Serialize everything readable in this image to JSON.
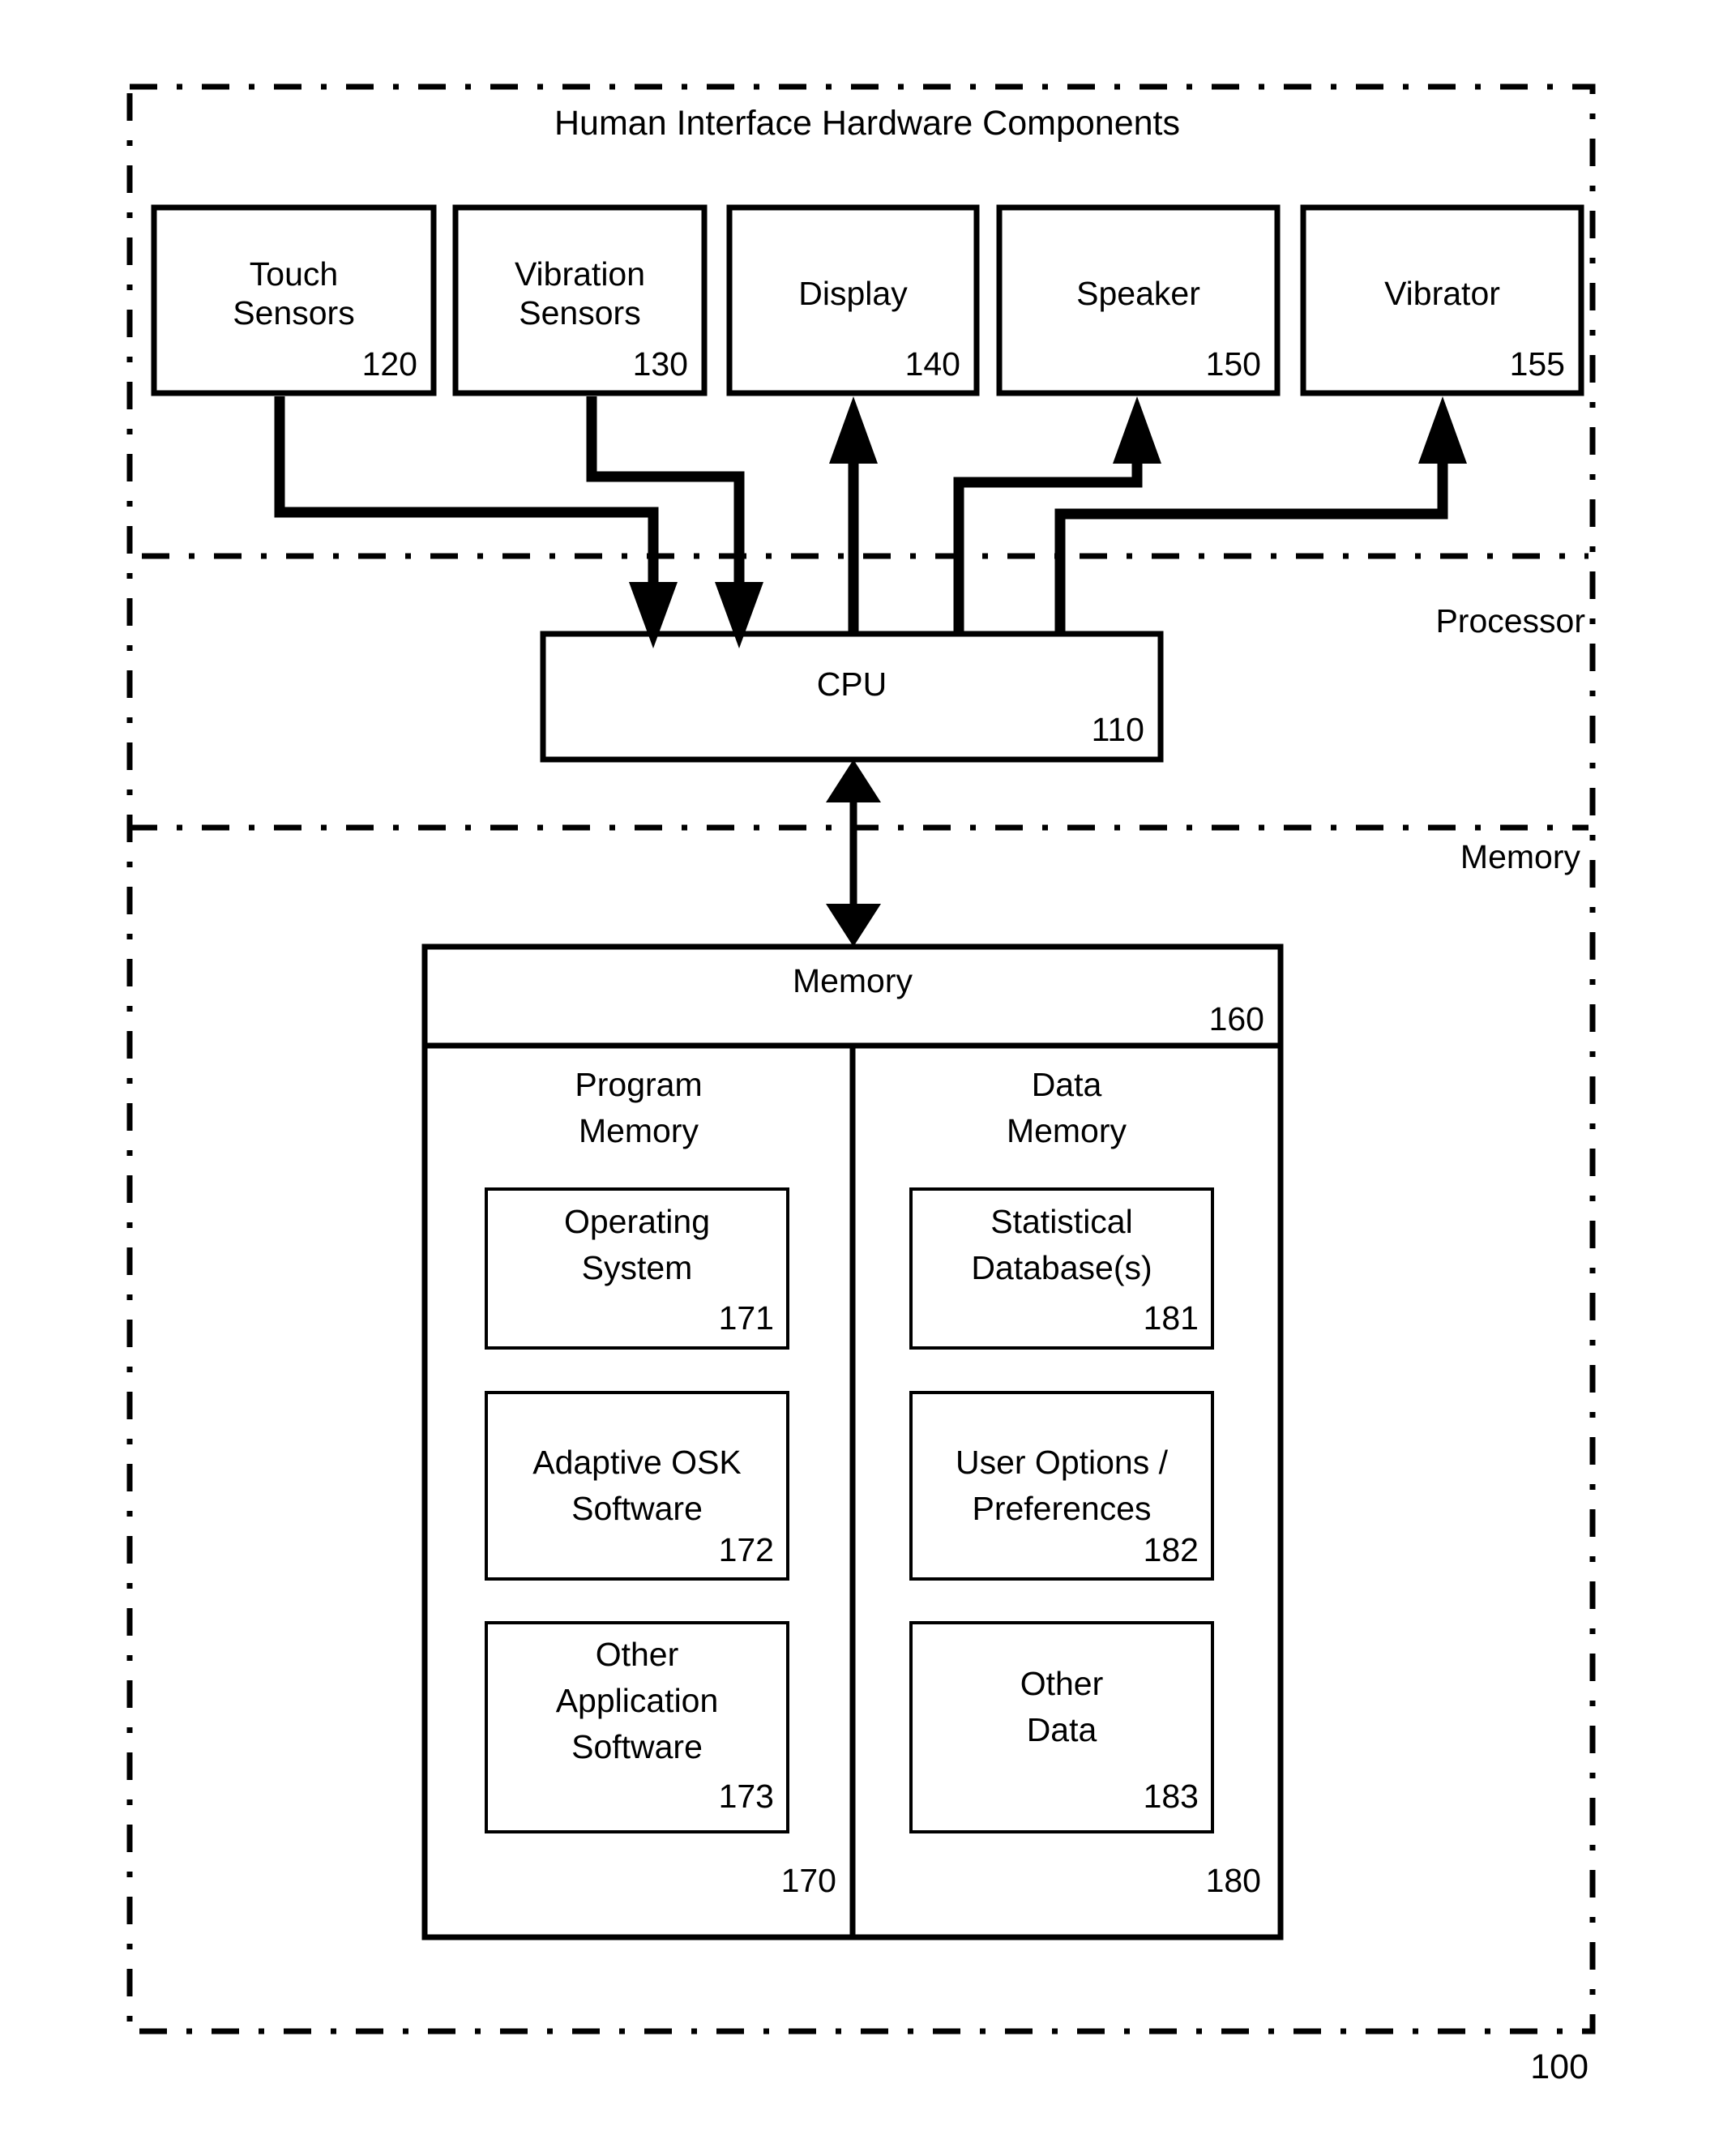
{
  "figure": {
    "outer_label": "100",
    "title": "Human Interface Hardware Components",
    "section_labels": {
      "processor": "Processor",
      "memory": "Memory"
    }
  },
  "hardware_components": [
    {
      "name": "touch-sensors",
      "label_line1": "Touch",
      "label_line2": "Sensors",
      "ref": "120"
    },
    {
      "name": "vibration-sensors",
      "label_line1": "Vibration",
      "label_line2": "Sensors",
      "ref": "130"
    },
    {
      "name": "display",
      "label_line1": "Display",
      "label_line2": "",
      "ref": "140"
    },
    {
      "name": "speaker",
      "label_line1": "Speaker",
      "label_line2": "",
      "ref": "150"
    },
    {
      "name": "vibrator",
      "label_line1": "Vibrator",
      "label_line2": "",
      "ref": "155"
    }
  ],
  "processor": {
    "cpu": {
      "label": "CPU",
      "ref": "110"
    }
  },
  "memory": {
    "header": {
      "label": "Memory",
      "ref": "160"
    },
    "program_memory": {
      "title_line1": "Program",
      "title_line2": "Memory",
      "ref": "170",
      "items": [
        {
          "line1": "Operating",
          "line2": "System",
          "line3": "",
          "ref": "171"
        },
        {
          "line1": "Adaptive OSK",
          "line2": "Software",
          "line3": "",
          "ref": "172"
        },
        {
          "line1": "Other",
          "line2": "Application",
          "line3": "Software",
          "ref": "173"
        }
      ]
    },
    "data_memory": {
      "title_line1": "Data",
      "title_line2": "Memory",
      "ref": "180",
      "items": [
        {
          "line1": "Statistical",
          "line2": "Database(s)",
          "line3": "",
          "ref": "181"
        },
        {
          "line1": "User Options /",
          "line2": "Preferences",
          "line3": "",
          "ref": "182"
        },
        {
          "line1": "Other",
          "line2": "Data",
          "line3": "",
          "ref": "183"
        }
      ]
    }
  },
  "colors": {
    "ink": "#000000",
    "paper": "#ffffff"
  }
}
